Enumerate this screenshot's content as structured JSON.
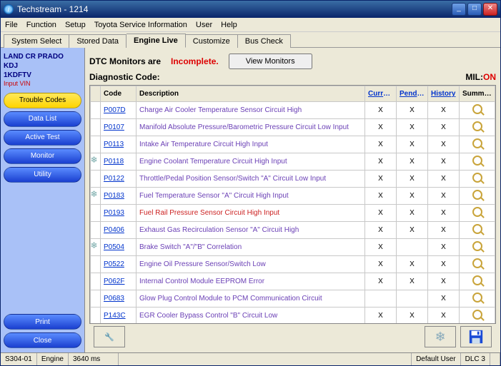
{
  "window": {
    "title": "Techstream - 1214"
  },
  "menu": {
    "file": "File",
    "function": "Function",
    "setup": "Setup",
    "tsi": "Toyota Service Information",
    "user": "User",
    "help": "Help"
  },
  "tabs": {
    "system_select": "System Select",
    "stored_data": "Stored Data",
    "engine_live": "Engine Live",
    "customize": "Customize",
    "bus_check": "Bus Check"
  },
  "vehicle": {
    "line1": "LAND CR PRADO",
    "line2": "KDJ",
    "line3": "1KDFTV",
    "input_vin": "Input VIN"
  },
  "sidebar": {
    "trouble_codes": "Trouble Codes",
    "data_list": "Data List",
    "active_test": "Active Test",
    "monitor": "Monitor",
    "utility": "Utility",
    "print": "Print",
    "close": "Close"
  },
  "dtc": {
    "label": "DTC Monitors are",
    "status": "Incomplete.",
    "view_monitors": "View Monitors",
    "diag_label": "Diagnostic Code:",
    "mil_label": "MIL:",
    "mil_value": "ON"
  },
  "columns": {
    "code": "Code",
    "desc": "Description",
    "current": "Current",
    "pending": "Pending",
    "history": "History",
    "summary": "Summary"
  },
  "rows": [
    {
      "flag": "",
      "code": "P007D",
      "desc": "Charge Air Cooler Temperature Sensor Circuit High",
      "cur": "X",
      "pen": "X",
      "his": "X",
      "red": false
    },
    {
      "flag": "",
      "code": "P0107",
      "desc": "Manifold Absolute Pressure/Barometric Pressure Circuit Low Input",
      "cur": "X",
      "pen": "X",
      "his": "X",
      "red": false
    },
    {
      "flag": "",
      "code": "P0113",
      "desc": "Intake Air Temperature Circuit High Input",
      "cur": "X",
      "pen": "X",
      "his": "X",
      "red": false
    },
    {
      "flag": "❄",
      "code": "P0118",
      "desc": "Engine Coolant Temperature Circuit High Input",
      "cur": "X",
      "pen": "X",
      "his": "X",
      "red": false
    },
    {
      "flag": "",
      "code": "P0122",
      "desc": "Throttle/Pedal Position Sensor/Switch \"A\" Circuit Low Input",
      "cur": "X",
      "pen": "X",
      "his": "X",
      "red": false
    },
    {
      "flag": "❄",
      "code": "P0183",
      "desc": "Fuel Temperature Sensor \"A\" Circuit High Input",
      "cur": "X",
      "pen": "X",
      "his": "X",
      "red": false
    },
    {
      "flag": "",
      "code": "P0193",
      "desc": "Fuel Rail Pressure Sensor Circuit High Input",
      "cur": "X",
      "pen": "X",
      "his": "X",
      "red": true
    },
    {
      "flag": "",
      "code": "P0406",
      "desc": "Exhaust Gas Recirculation Sensor \"A\" Circuit High",
      "cur": "X",
      "pen": "X",
      "his": "X",
      "red": false
    },
    {
      "flag": "❄",
      "code": "P0504",
      "desc": "Brake Switch \"A\"/\"B\" Correlation",
      "cur": "X",
      "pen": "",
      "his": "X",
      "red": false
    },
    {
      "flag": "",
      "code": "P0522",
      "desc": "Engine Oil Pressure Sensor/Switch Low",
      "cur": "X",
      "pen": "X",
      "his": "X",
      "red": false
    },
    {
      "flag": "",
      "code": "P062F",
      "desc": "Internal Control Module EEPROM Error",
      "cur": "X",
      "pen": "X",
      "his": "X",
      "red": false
    },
    {
      "flag": "",
      "code": "P0683",
      "desc": "Glow Plug Control Module to PCM Communication Circuit",
      "cur": "",
      "pen": "",
      "his": "X",
      "red": false
    },
    {
      "flag": "",
      "code": "P143C",
      "desc": "EGR Cooler Bypass Control \"B\" Circuit Low",
      "cur": "X",
      "pen": "X",
      "his": "X",
      "red": false
    }
  ],
  "status": {
    "left": "S304-01",
    "engine": "Engine",
    "ms": "3640 ms",
    "user": "Default User",
    "dlc": "DLC 3"
  }
}
